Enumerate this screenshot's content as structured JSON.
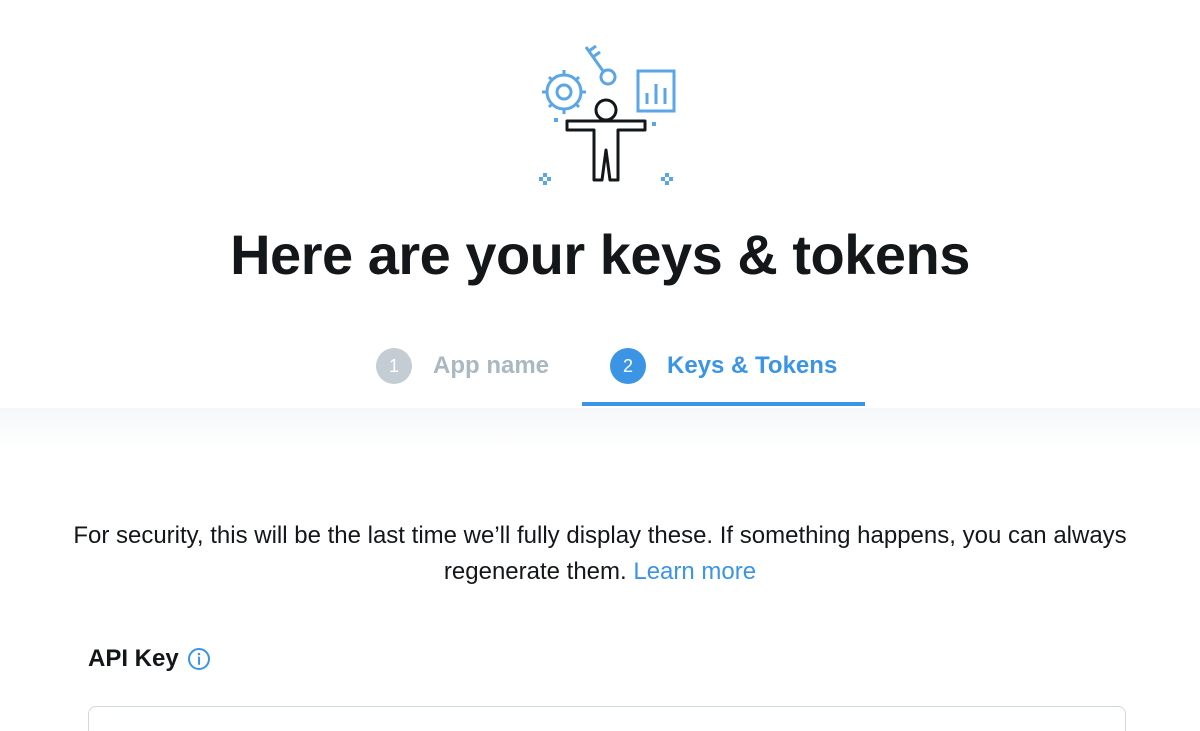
{
  "header": {
    "illustration": "developer-keys-illustration",
    "title": "Here are your keys & tokens"
  },
  "stepper": {
    "steps": [
      {
        "number": "1",
        "label": "App name",
        "state": "completed"
      },
      {
        "number": "2",
        "label": "Keys & Tokens",
        "state": "active"
      }
    ]
  },
  "notice": {
    "text": "For security, this will be the last time we’ll fully display these. If something happens, you can always regenerate them.",
    "link": "Learn more"
  },
  "api_key": {
    "label": "API Key",
    "info_icon": "info-icon",
    "value": ""
  },
  "colors": {
    "accent": "#3b94e4",
    "muted": "#aab8c2",
    "title": "#14171a"
  }
}
